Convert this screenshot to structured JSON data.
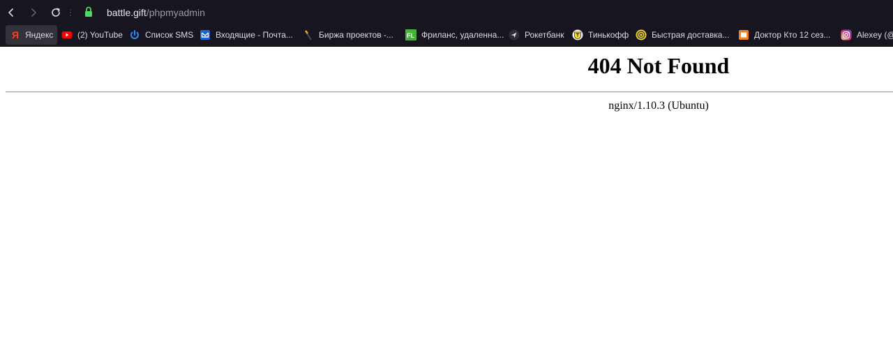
{
  "browser": {
    "address_host": "battle.gift",
    "address_path": "/phpmyadmin",
    "bookmarks": [
      {
        "label": "Яндекс",
        "icon": "yandex-icon"
      },
      {
        "label": "(2) YouTube",
        "icon": "youtube-icon"
      },
      {
        "label": "Список SMS",
        "icon": "power-icon"
      },
      {
        "label": "Входящие - Почта...",
        "icon": "mail-icon"
      },
      {
        "label": "Биржа проектов -...",
        "icon": "kwork-icon"
      },
      {
        "label": "Фриланс, удаленна...",
        "icon": "fl-icon"
      },
      {
        "label": "Рокетбанк",
        "icon": "rocketbank-icon"
      },
      {
        "label": "Тинькофф",
        "icon": "tinkoff-icon"
      },
      {
        "label": "Быстрая доставка...",
        "icon": "delivery-icon"
      },
      {
        "label": "Доктор Кто 12 сез...",
        "icon": "video-icon"
      },
      {
        "label": "Alexey (@",
        "icon": "instagram-icon"
      }
    ]
  },
  "page": {
    "heading": "404 Not Found",
    "server": "nginx/1.10.3 (Ubuntu)"
  },
  "colors": {
    "chrome_bg": "#17151f",
    "lock_green": "#4cd964",
    "youtube_red": "#ff0000"
  }
}
